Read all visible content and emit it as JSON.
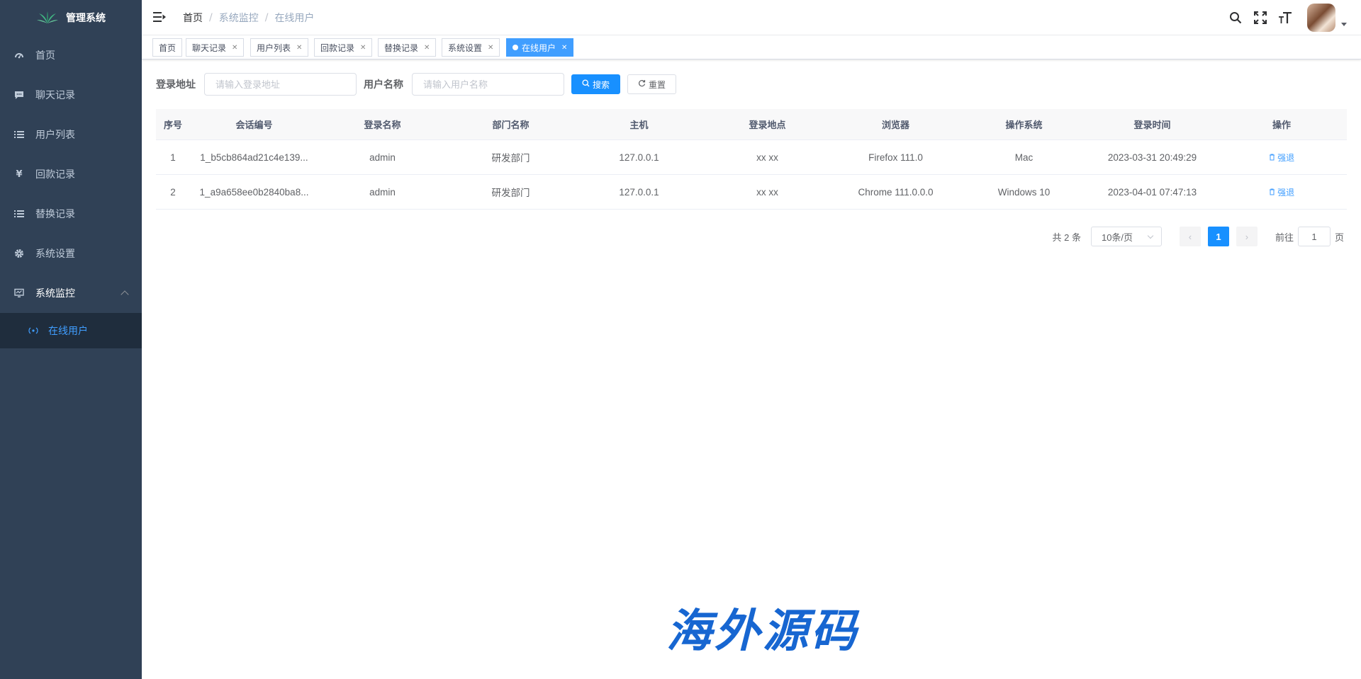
{
  "app": {
    "title": "管理系统"
  },
  "sidebar": {
    "items": [
      {
        "label": "首页",
        "icon": "dashboard-icon"
      },
      {
        "label": "聊天记录",
        "icon": "message-icon"
      },
      {
        "label": "用户列表",
        "icon": "list-icon"
      },
      {
        "label": "回款记录",
        "icon": "yen-icon"
      },
      {
        "label": "替换记录",
        "icon": "list-icon"
      },
      {
        "label": "系统设置",
        "icon": "gear-icon"
      },
      {
        "label": "系统监控",
        "icon": "monitor-icon"
      }
    ],
    "sub_item": {
      "label": "在线用户",
      "icon": "online-icon"
    }
  },
  "breadcrumb": {
    "items": [
      "首页",
      "系统监控",
      "在线用户"
    ]
  },
  "tags": [
    {
      "label": "首页"
    },
    {
      "label": "聊天记录"
    },
    {
      "label": "用户列表"
    },
    {
      "label": "回款记录"
    },
    {
      "label": "替换记录"
    },
    {
      "label": "系统设置"
    },
    {
      "label": "在线用户"
    }
  ],
  "search": {
    "login_address_label": "登录地址",
    "login_address_placeholder": "请输入登录地址",
    "username_label": "用户名称",
    "username_placeholder": "请输入用户名称",
    "search_button": "搜索",
    "reset_button": "重置"
  },
  "table": {
    "headers": [
      "序号",
      "会话编号",
      "登录名称",
      "部门名称",
      "主机",
      "登录地点",
      "浏览器",
      "操作系统",
      "登录时间",
      "操作"
    ],
    "rows": [
      [
        "1",
        "1_b5cb864ad21c4e139...",
        "admin",
        "研发部门",
        "127.0.0.1",
        "xx xx",
        "Firefox 111.0",
        "Mac",
        "2023-03-31 20:49:29",
        "强退"
      ],
      [
        "2",
        "1_a9a658ee0b2840ba8...",
        "admin",
        "研发部门",
        "127.0.0.1",
        "xx xx",
        "Chrome 111.0.0.0",
        "Windows 10",
        "2023-04-01 07:47:13",
        "强退"
      ]
    ]
  },
  "pagination": {
    "total_text": "共 2 条",
    "page_size": "10条/页",
    "current_page": "1",
    "goto_label": "前往",
    "goto_value": "1",
    "page_suffix": "页"
  },
  "watermark": {
    "text": "海外源码"
  },
  "colors": {
    "sidebar_bg": "#304156",
    "primary": "#1890ff",
    "active_link": "#409eff"
  }
}
